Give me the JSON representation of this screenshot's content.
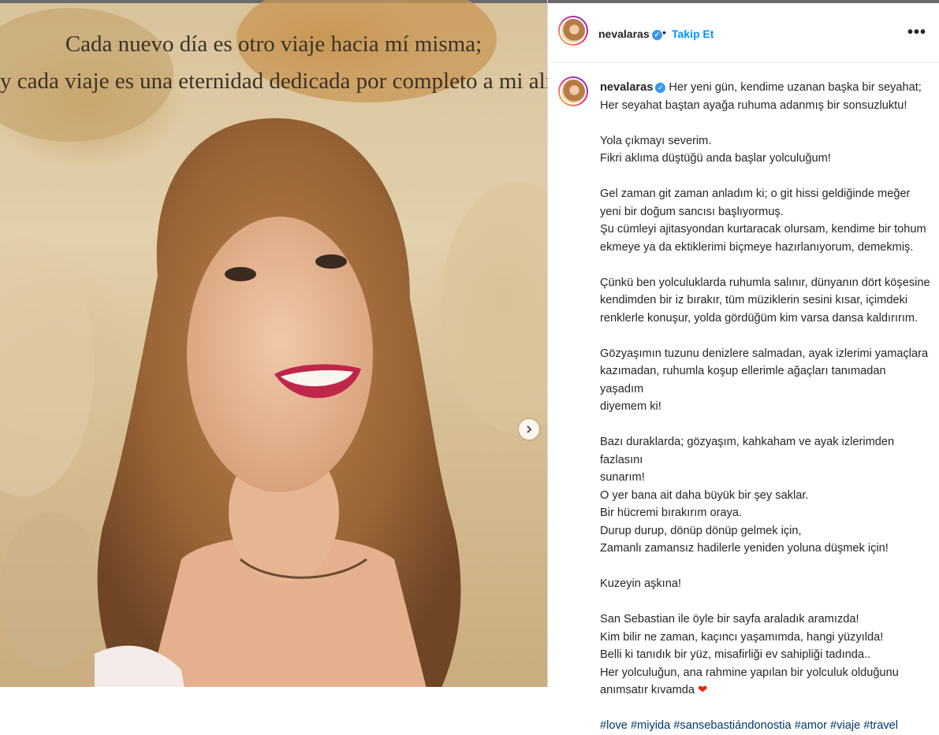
{
  "post": {
    "image": {
      "caption_lines": [
        "Cada nuevo día es otro viaje hacia mí misma;",
        "y cada viaje es una eternidad dedicada por completo a mi alma."
      ]
    }
  },
  "header": {
    "username": "nevalaras",
    "separator": "•",
    "follow_label": "Takip Et",
    "more_label": "•••"
  },
  "caption": {
    "username": "nevalaras",
    "lines": [
      "Her yeni gün, kendime uzanan başka bir seyahat;",
      "Her seyahat baştan ayağa ruhuma adanmış bir sonsuzluktu!",
      "",
      "Yola çıkmayı severim.",
      "Fikri aklıma düştüğü anda başlar yolculuğum!",
      "",
      "Gel zaman git zaman anladım ki; o git hissi geldiğinde meğer",
      "yeni bir doğum sancısı başlıyormuş.",
      "Şu cümleyi ajitasyondan kurtaracak olursam, kendime bir tohum",
      "ekmeye ya da ektiklerimi biçmeye hazırlanıyorum, demekmiş.",
      "",
      "Çünkü ben yolculuklarda ruhumla salınır, dünyanın dört köşesine",
      "kendimden bir iz bırakır, tüm müziklerin sesini kısar, içimdeki",
      "renklerle konuşur, yolda gördüğüm kim varsa dansa kaldırırım.",
      "",
      "Gözyaşımın tuzunu denizlere salmadan, ayak izlerimi yamaçlara",
      "kazımadan, ruhumla koşup ellerimle ağaçları tanımadan yaşadım",
      "diyemem ki!",
      "",
      "Bazı duraklarda; gözyaşım, kahkaham ve ayak izlerimden fazlasını",
      "sunarım!",
      "O yer bana ait daha büyük bir şey saklar.",
      "Bir hücremi bırakırım oraya.",
      "Durup durup, dönüp dönüp gelmek için,",
      "Zamanlı zamansız hadilerle yeniden yoluna düşmek için!",
      "",
      "Kuzeyin aşkına!",
      "",
      "San Sebastian ile öyle bir sayfa araladık aramızda!",
      "Kim bilir ne zaman, kaçıncı yaşamımda, hangi yüzyılda!",
      "Belli ki tanıdık bir yüz, misafirliği ev sahipliği tadında..",
      "Her yolculuğun, ana rahmine yapılan bir yolculuk olduğunu",
      "anımsatır kıvamda"
    ],
    "heart": "❤",
    "hashtags": "#love #miyida #sansebastiándonostia #amor #viaje #travel"
  }
}
